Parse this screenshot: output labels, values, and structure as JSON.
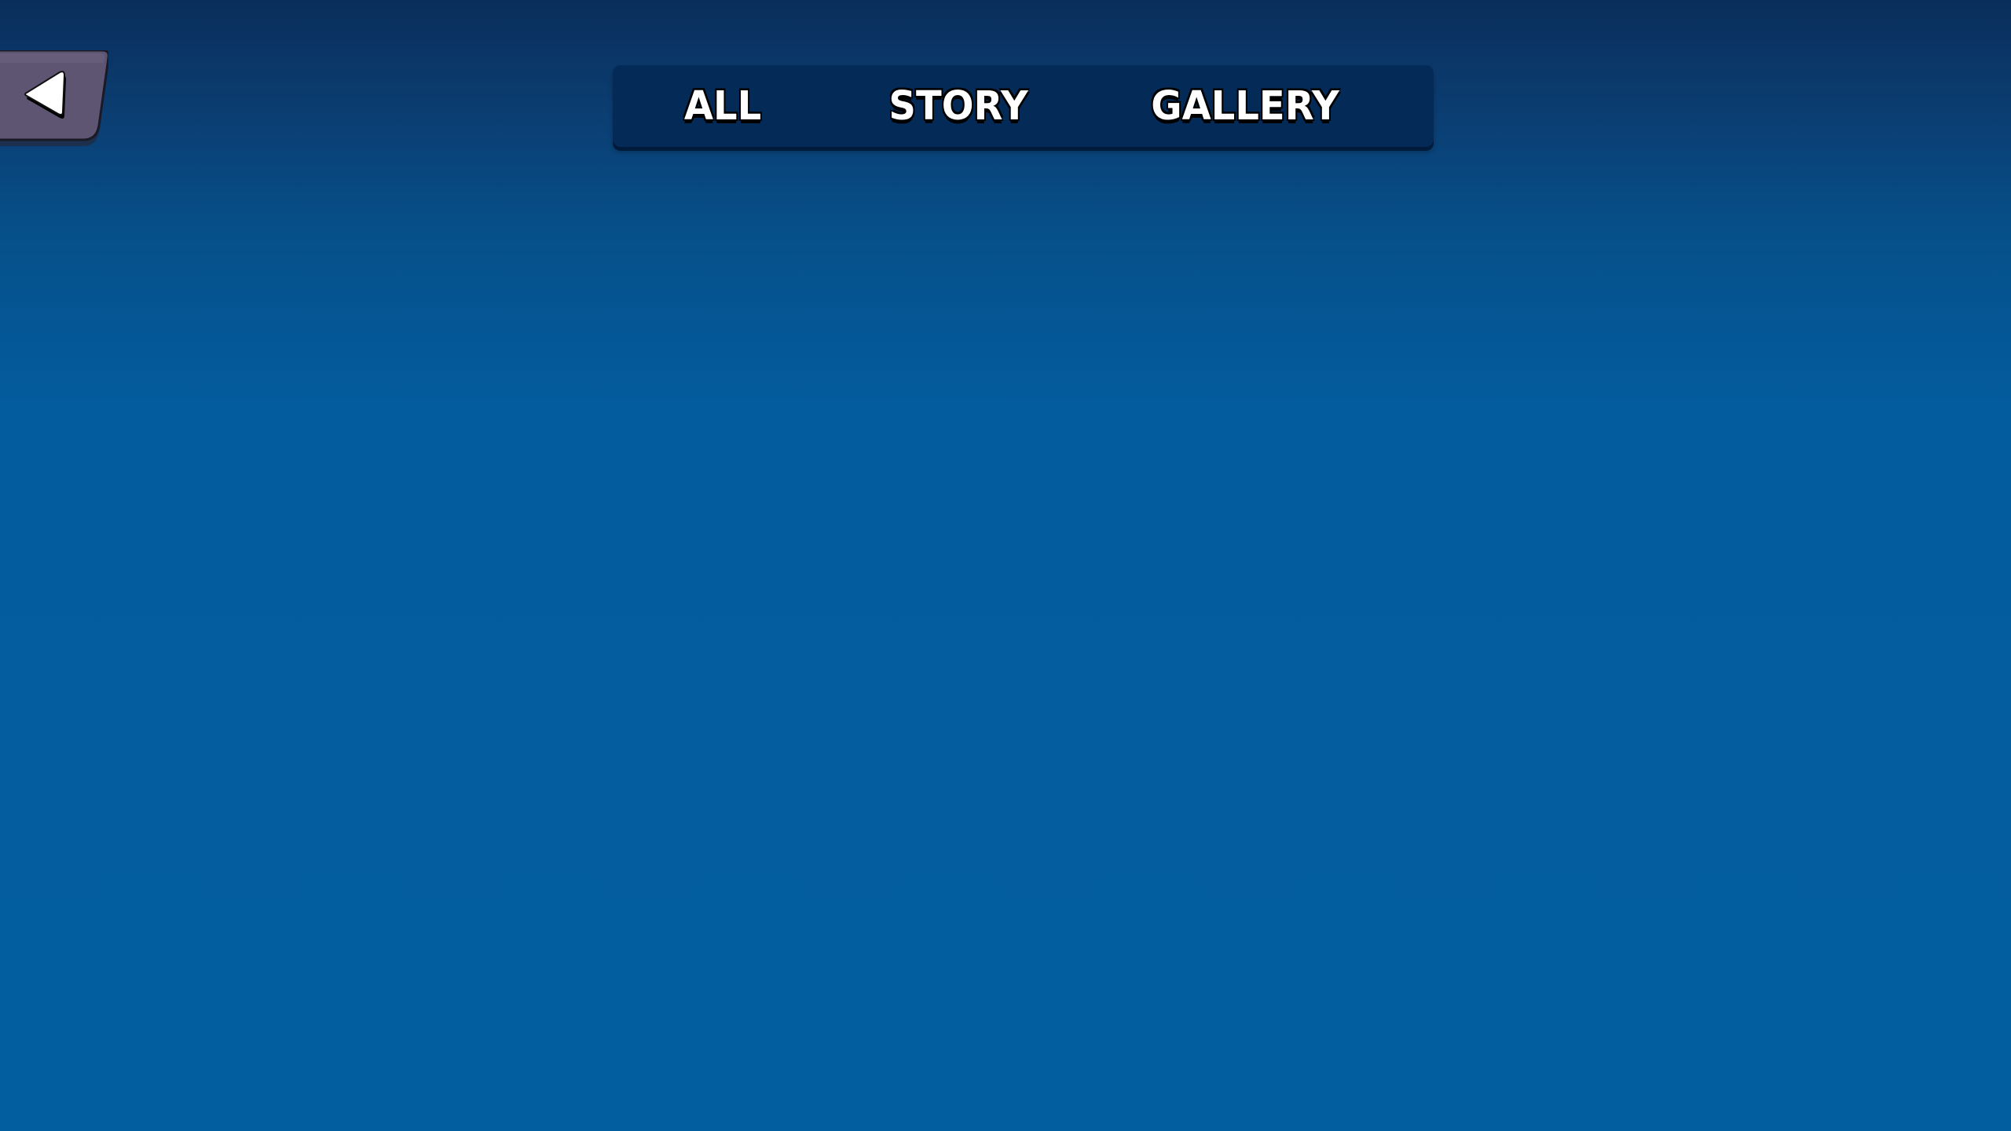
{
  "header": {
    "back_button": {
      "icon": "triangle-left-icon",
      "color": "#5c5470"
    },
    "tabs": [
      {
        "label": "ALL"
      },
      {
        "label": "STORY"
      },
      {
        "label": "GALLERY"
      }
    ]
  },
  "colors": {
    "background_top": "#0a2e5b",
    "background_main": "#035e9f",
    "tab_bar": "#042a57",
    "back_button": "#5c5470"
  }
}
